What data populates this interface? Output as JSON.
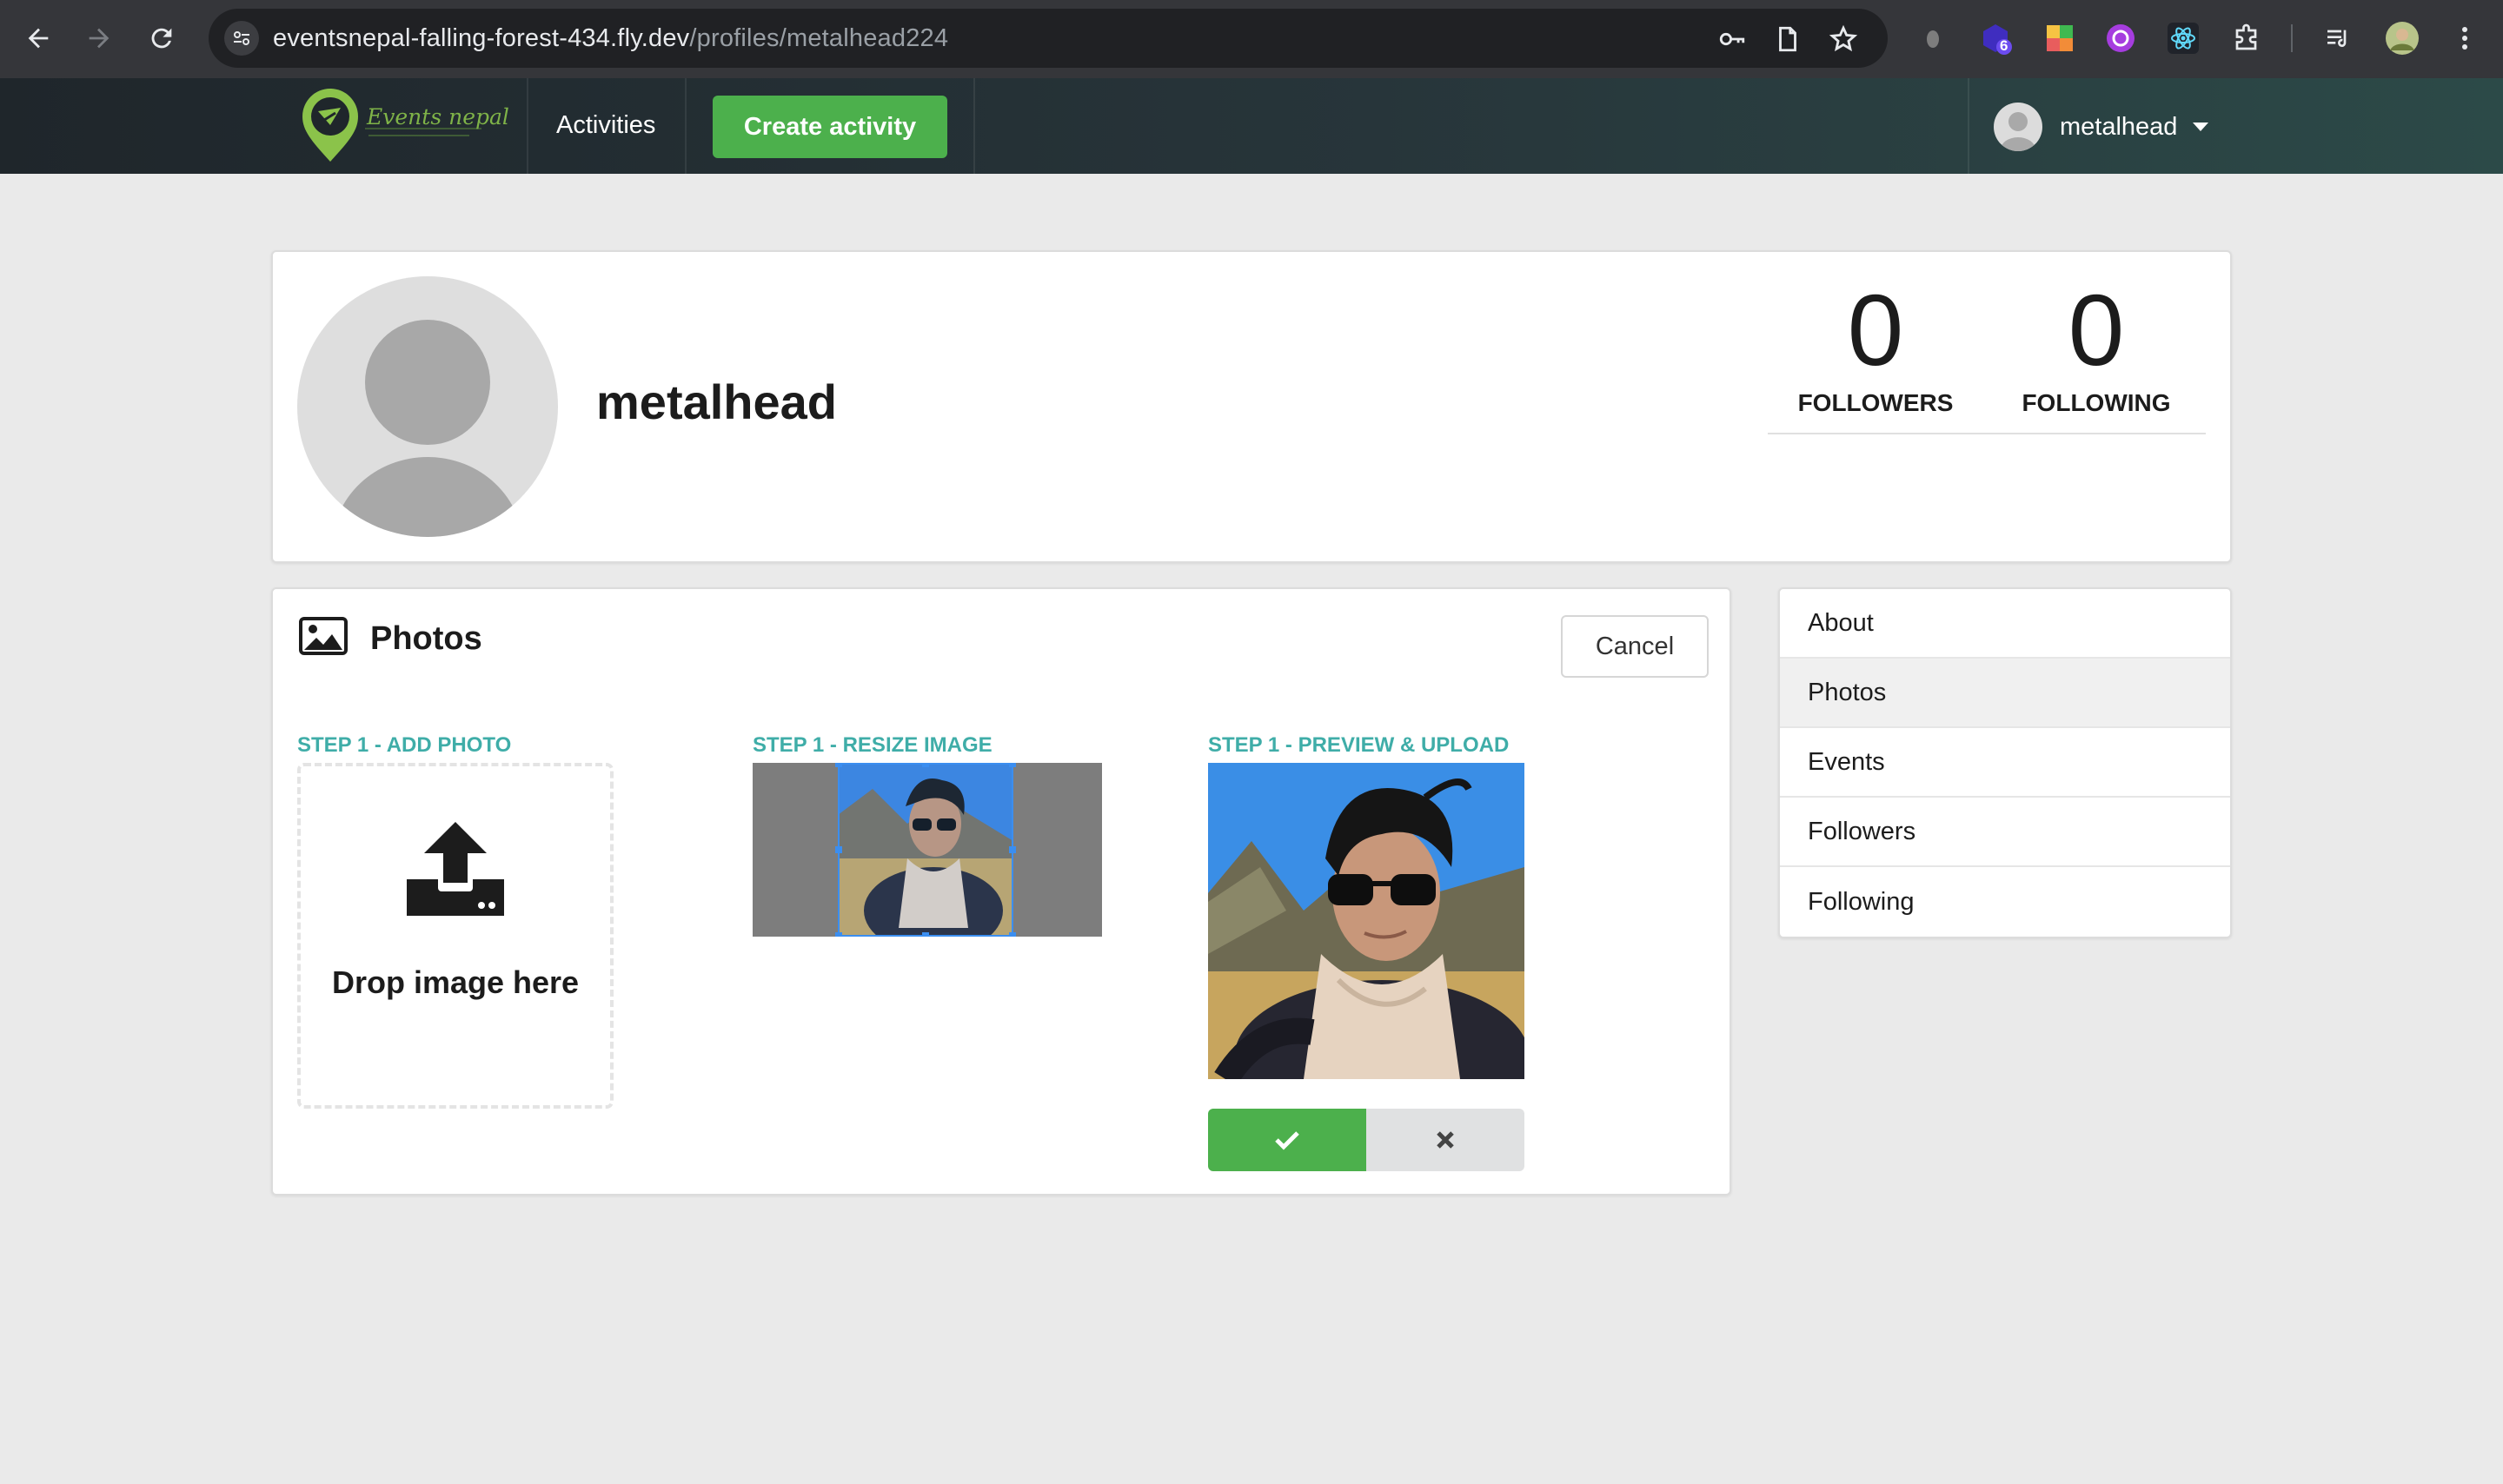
{
  "browser": {
    "url_host": "eventsnepal-falling-forest-434.fly.dev",
    "url_path": "/profiles/metalhead224",
    "extension_badge": "6"
  },
  "navbar": {
    "logo_text": "Events nepal",
    "activities_label": "Activities",
    "create_activity_label": "Create activity",
    "username": "metalhead"
  },
  "profile": {
    "display_name": "metalhead",
    "followers_count": "0",
    "followers_label": "FOLLOWERS",
    "following_count": "0",
    "following_label": "FOLLOWING"
  },
  "photos": {
    "title": "Photos",
    "cancel_label": "Cancel",
    "step_add": "STEP 1 - ADD PHOTO",
    "step_resize": "STEP 1 - RESIZE IMAGE",
    "step_preview": "STEP 1 - PREVIEW & UPLOAD",
    "drop_text": "Drop image here"
  },
  "side_menu": {
    "items": [
      {
        "label": "About"
      },
      {
        "label": "Photos"
      },
      {
        "label": "Events"
      },
      {
        "label": "Followers"
      },
      {
        "label": "Following"
      }
    ],
    "active": "Photos"
  },
  "colors": {
    "accent_green": "#4cb04c",
    "step_teal": "#3fada8",
    "crop_blue": "#3b8ef0"
  }
}
